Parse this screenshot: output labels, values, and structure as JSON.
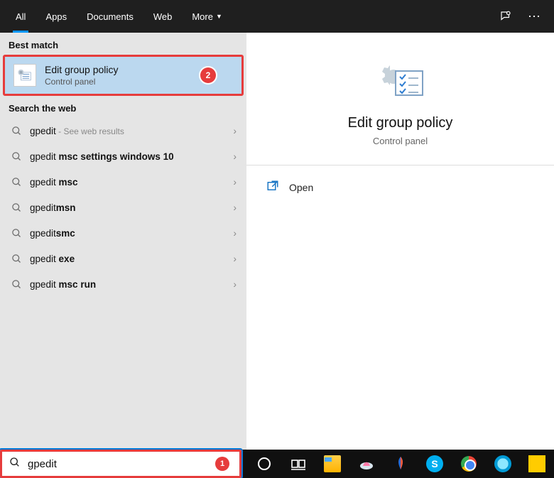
{
  "tabs": {
    "all": "All",
    "apps": "Apps",
    "documents": "Documents",
    "web": "Web",
    "more": "More"
  },
  "left": {
    "best_heading": "Best match",
    "best": {
      "title": "Edit group policy",
      "subtitle": "Control panel",
      "badge": "2"
    },
    "web_heading": "Search the web",
    "web_items": [
      {
        "prefix": "gpedit",
        "bold": "",
        "hint": " - See web results"
      },
      {
        "prefix": "gpedit ",
        "bold": "msc settings windows 10",
        "hint": ""
      },
      {
        "prefix": "gpedit ",
        "bold": "msc",
        "hint": ""
      },
      {
        "prefix": "gpedit",
        "bold": "msn",
        "hint": ""
      },
      {
        "prefix": "gpedit",
        "bold": "smc",
        "hint": ""
      },
      {
        "prefix": "gpedit ",
        "bold": "exe",
        "hint": ""
      },
      {
        "prefix": "gpedit ",
        "bold": "msc run",
        "hint": ""
      }
    ]
  },
  "preview": {
    "title": "Edit group policy",
    "subtitle": "Control panel",
    "actions": {
      "open": "Open"
    }
  },
  "search": {
    "value": "gpedit",
    "badge": "1"
  }
}
